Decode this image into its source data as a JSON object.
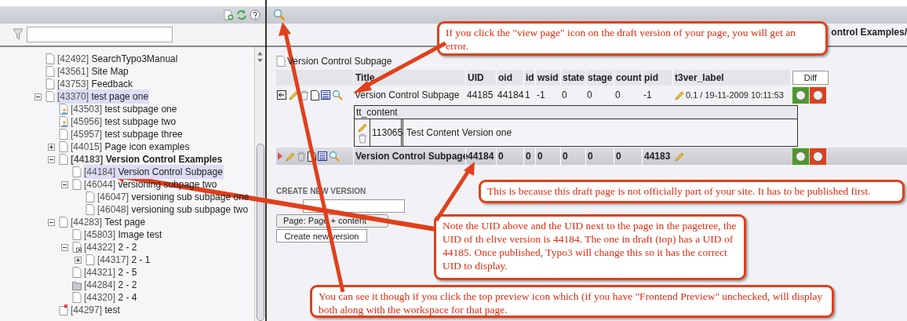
{
  "tree": [
    {
      "id_label": "[42492]",
      "title": "SearchTypo3Manual",
      "kind": "page",
      "collapsed": false,
      "selected": false,
      "bold": false
    },
    {
      "id_label": "[43561]",
      "title": "Site Map",
      "kind": "page",
      "collapsed": false,
      "selected": false,
      "bold": false
    },
    {
      "id_label": "[43753]",
      "title": "Feedback",
      "kind": "page",
      "collapsed": false,
      "selected": false,
      "bold": false
    },
    {
      "id_label": "[43370]",
      "title": "test page one",
      "kind": "page",
      "collapsed": false,
      "selected": true,
      "bold": false,
      "children": [
        {
          "id_label": "[43503]",
          "title": "test subpage one",
          "kind": "user",
          "collapsed": false,
          "selected": false,
          "bold": false
        },
        {
          "id_label": "[45956]",
          "title": "test subpage two",
          "kind": "user",
          "collapsed": false,
          "selected": false,
          "bold": false
        },
        {
          "id_label": "[45957]",
          "title": "test subpage three",
          "kind": "page",
          "collapsed": false,
          "selected": false,
          "bold": false
        },
        {
          "id_label": "[44015]",
          "title": "Page icon examples",
          "kind": "page",
          "collapsed": true,
          "selected": false,
          "bold": false
        },
        {
          "id_label": "[44183]",
          "title": "Version Control Examples",
          "kind": "page",
          "collapsed": false,
          "selected": false,
          "bold": true,
          "children": [
            {
              "id_label": "[44184]",
              "title": "Version Control Subpage",
              "kind": "page",
              "collapsed": false,
              "selected": true,
              "bold": false
            },
            {
              "id_label": "[46044]",
              "title": "versioning subpage two",
              "kind": "page",
              "collapsed": false,
              "selected": false,
              "bold": false,
              "children": [
                {
                  "id_label": "[46047]",
                  "title": "versioning sub subpage one",
                  "kind": "page",
                  "collapsed": false,
                  "selected": false,
                  "bold": false
                },
                {
                  "id_label": "[46048]",
                  "title": "versioning sub subpage two",
                  "kind": "page",
                  "collapsed": false,
                  "selected": false,
                  "bold": false
                }
              ]
            }
          ]
        },
        {
          "id_label": "[44283]",
          "title": "Test page",
          "kind": "page",
          "collapsed": false,
          "selected": false,
          "bold": false,
          "children": [
            {
              "id_label": "[45803]",
              "title": "Image test",
              "kind": "page",
              "collapsed": false,
              "selected": false,
              "bold": false
            },
            {
              "id_label": "[44322]",
              "title": "2 - 2",
              "kind": "shortcut",
              "collapsed": false,
              "selected": false,
              "bold": false,
              "children": [
                {
                  "id_label": "[44317]",
                  "title": "2 - 1",
                  "kind": "page",
                  "collapsed": true,
                  "selected": false,
                  "bold": false
                }
              ]
            },
            {
              "id_label": "[44321]",
              "title": "2 - 5",
              "kind": "page",
              "collapsed": false,
              "selected": false,
              "bold": false
            },
            {
              "id_label": "[44284]",
              "title": "2 - 2",
              "kind": "folder",
              "collapsed": false,
              "selected": false,
              "bold": false
            },
            {
              "id_label": "[44320]",
              "title": "2 - 4",
              "kind": "page",
              "collapsed": false,
              "selected": false,
              "bold": false
            }
          ]
        },
        {
          "id_label": "[44297]",
          "title": "test",
          "kind": "deleted",
          "collapsed": false,
          "selected": false,
          "bold": false
        }
      ]
    }
  ],
  "main": {
    "breadcrumb": "ontrol Examples/",
    "page_title": "Version Control Subpage",
    "columns": [
      "Title",
      "UID",
      "oid",
      "id",
      "wsid",
      "state",
      "stage",
      "count",
      "pid",
      "t3ver_label"
    ],
    "diff_button": "Diff",
    "rows": [
      {
        "kind": "draft",
        "cells": [
          "Version Control Subpage",
          "44185",
          "44184",
          "1",
          "-1",
          "0",
          "0",
          "0",
          "-1"
        ],
        "label": "0.1 / 19-11-2009 10:11:53",
        "content": {
          "table": "tt_content",
          "uid": "113065",
          "title": "Test Content Version one"
        }
      },
      {
        "kind": "live",
        "cells": [
          "Version Control Subpage",
          "44184",
          "0",
          "0",
          "0",
          "0",
          "0",
          "0",
          "44183"
        ]
      }
    ],
    "create": {
      "heading": "CREATE NEW VERSION",
      "select": "Page: Page + content",
      "button": "Create new version"
    }
  },
  "callouts": [
    {
      "text": "If you click the \"view page\" icon on the draft version of your page, you will get an error."
    },
    {
      "text": "This is because this draft page is not officially part of your site.  It has to be published first."
    },
    {
      "text": "Note the UID above and the UID next to the page in the pagetree, the UID of th elive version is 44184.  The one in draft (top) has a UID of 44185.  Once published, Typo3 will change this so it has the correct UID to display."
    },
    {
      "text": "You can see it though if you click the top preview icon which (if you have \"Frontend Preview\" unchecked, will display both along with the workspace for that  page."
    }
  ]
}
